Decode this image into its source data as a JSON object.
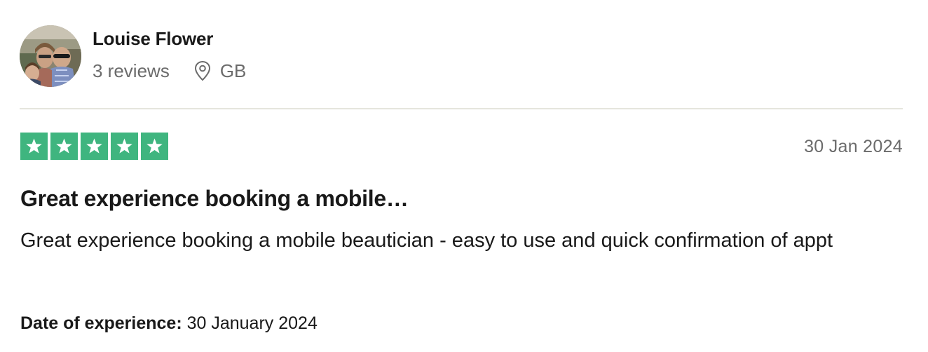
{
  "reviewer": {
    "name": "Louise Flower",
    "reviews_count": "3 reviews",
    "country": "GB"
  },
  "review": {
    "rating_stars": 5,
    "rating_max": 5,
    "star_color": "#3fb57f",
    "date": "30 Jan 2024",
    "title": "Great experience booking a mobile…",
    "body": "Great experience booking a mobile beautician - easy to use and quick confirmation of appt",
    "date_of_experience_label": "Date of experience:",
    "date_of_experience_value": "30 January 2024"
  },
  "icons": {
    "location": "location-pin-icon",
    "star": "star-icon"
  }
}
